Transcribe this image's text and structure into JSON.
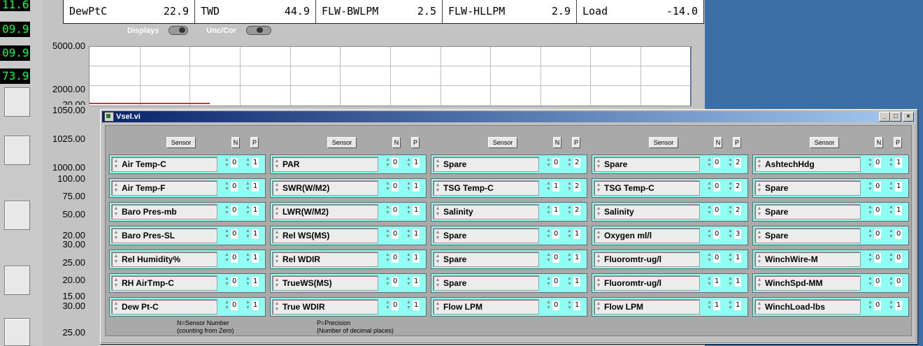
{
  "left_readouts": [
    "11.6",
    "09.9",
    "09.9",
    "73.9"
  ],
  "top_table": [
    {
      "label": "DewPtC",
      "value": "22.9"
    },
    {
      "label": "TWD",
      "value": "44.9"
    },
    {
      "label": "FLW-BWLPM",
      "value": "2.5"
    },
    {
      "label": "FLW-HLLPM",
      "value": "2.9"
    },
    {
      "label": "Load",
      "value": "-14.0"
    }
  ],
  "toggles": {
    "displays": "Displays",
    "unc_cor": "Unc/Cor"
  },
  "graph": {
    "y_labels_top": [
      "5000.00",
      "2000.00",
      "20.00"
    ],
    "y_labels_side": [
      "1050.00",
      "1025.00",
      "1000.00",
      "100.00",
      "75.00",
      "50.00",
      "20.00",
      "30.00",
      "25.00",
      "20.00",
      "15.00",
      "30.00",
      "25.00"
    ]
  },
  "vsel": {
    "title": "Vsel.vi",
    "min_btn": "_",
    "max_btn": "□",
    "close_btn": "×",
    "header": {
      "sensor": "Sensor",
      "n": "N",
      "p": "P"
    },
    "columns": [
      {
        "rows": [
          {
            "sensor": "Air Temp-C",
            "n": "0",
            "p": "1"
          },
          {
            "sensor": "Air Temp-F",
            "n": "0",
            "p": "1"
          },
          {
            "sensor": "Baro Pres-mb",
            "n": "0",
            "p": "1"
          },
          {
            "sensor": "Baro Pres-SL",
            "n": "0",
            "p": "1"
          },
          {
            "sensor": "Rel Humidity%",
            "n": "0",
            "p": "1"
          },
          {
            "sensor": "RH AirTmp-C",
            "n": "0",
            "p": "1"
          },
          {
            "sensor": "Dew Pt-C",
            "n": "0",
            "p": "1"
          }
        ]
      },
      {
        "rows": [
          {
            "sensor": "PAR",
            "n": "0",
            "p": "1"
          },
          {
            "sensor": "SWR(W/M2)",
            "n": "0",
            "p": "1"
          },
          {
            "sensor": "LWR(W/M2)",
            "n": "0",
            "p": "1"
          },
          {
            "sensor": "Rel WS(MS)",
            "n": "0",
            "p": "1"
          },
          {
            "sensor": "Rel WDIR",
            "n": "0",
            "p": "1"
          },
          {
            "sensor": "TrueWS(MS)",
            "n": "0",
            "p": "1"
          },
          {
            "sensor": "True WDIR",
            "n": "0",
            "p": "1"
          }
        ]
      },
      {
        "rows": [
          {
            "sensor": "Spare",
            "n": "0",
            "p": "2"
          },
          {
            "sensor": "TSG Temp-C",
            "n": "1",
            "p": "2"
          },
          {
            "sensor": "Salinity",
            "n": "1",
            "p": "2"
          },
          {
            "sensor": "Spare",
            "n": "0",
            "p": "1"
          },
          {
            "sensor": "Spare",
            "n": "0",
            "p": "1"
          },
          {
            "sensor": "Spare",
            "n": "0",
            "p": "1"
          },
          {
            "sensor": "Flow LPM",
            "n": "0",
            "p": "1"
          }
        ]
      },
      {
        "rows": [
          {
            "sensor": "Spare",
            "n": "0",
            "p": "2"
          },
          {
            "sensor": "TSG Temp-C",
            "n": "0",
            "p": "2"
          },
          {
            "sensor": "Salinity",
            "n": "0",
            "p": "2"
          },
          {
            "sensor": "Oxygen ml/l",
            "n": "0",
            "p": "3"
          },
          {
            "sensor": "Fluoromtr-ug/l",
            "n": "0",
            "p": "1"
          },
          {
            "sensor": "Fluoromtr-ug/l",
            "n": "1",
            "p": "1"
          },
          {
            "sensor": "Flow LPM",
            "n": "1",
            "p": "1"
          }
        ]
      },
      {
        "rows": [
          {
            "sensor": "AshtechHdg",
            "n": "0",
            "p": "1"
          },
          {
            "sensor": "Spare",
            "n": "0",
            "p": "1"
          },
          {
            "sensor": "Spare",
            "n": "0",
            "p": "1"
          },
          {
            "sensor": "Spare",
            "n": "0",
            "p": "0"
          },
          {
            "sensor": "WinchWire-M",
            "n": "0",
            "p": "0"
          },
          {
            "sensor": "WinchSpd-MM",
            "n": "0",
            "p": "0"
          },
          {
            "sensor": "WinchLoad-lbs",
            "n": "0",
            "p": "1"
          }
        ]
      }
    ],
    "notes": {
      "n_line1": "N=Sensor Number",
      "n_line2": "(counting from Zero)",
      "p_line1": "P=Precision",
      "p_line2": "(Number of decimal places)"
    }
  }
}
